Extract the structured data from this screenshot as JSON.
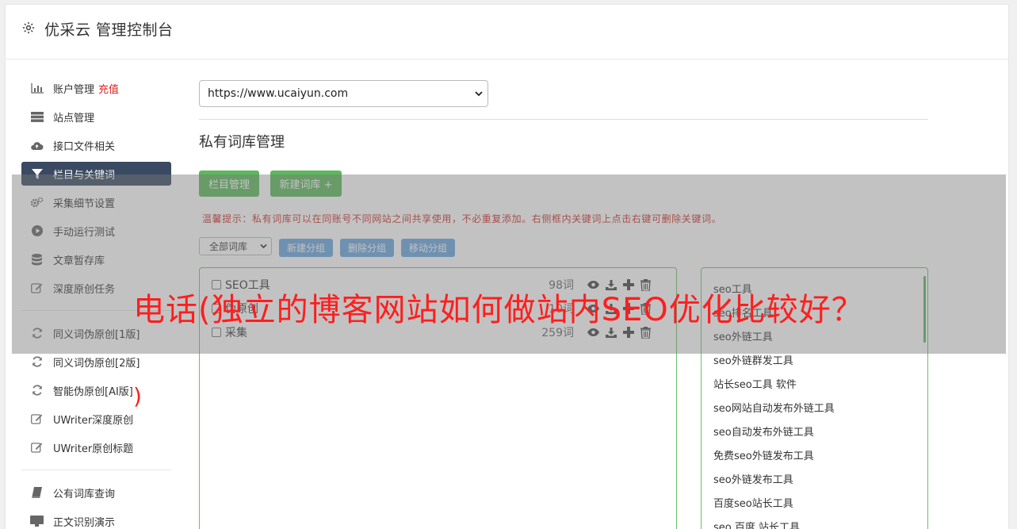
{
  "header": {
    "title": "优采云 管理控制台"
  },
  "sidebar": {
    "group1": [
      {
        "label": "账户管理",
        "badge": "充值",
        "icon": "bar-chart-icon"
      },
      {
        "label": "站点管理",
        "icon": "server-icon"
      },
      {
        "label": "接口文件相关",
        "icon": "cloud-upload-icon"
      },
      {
        "label": "栏目与关键词",
        "icon": "filter-icon",
        "active": true
      },
      {
        "label": "采集细节设置",
        "icon": "cogs-icon"
      },
      {
        "label": "手动运行测试",
        "icon": "play-circle-icon"
      },
      {
        "label": "文章暂存库",
        "icon": "database-icon"
      },
      {
        "label": "深度原创任务",
        "icon": "edit-icon"
      }
    ],
    "group2": [
      {
        "label": "同义词伪原创[1版]",
        "icon": "refresh-icon"
      },
      {
        "label": "同义词伪原创[2版]",
        "icon": "refresh-icon"
      },
      {
        "label": "智能伪原创[AI版]",
        "icon": "refresh-icon"
      },
      {
        "label": "UWriter深度原创",
        "icon": "edit-icon"
      },
      {
        "label": "UWriter原创标题",
        "icon": "edit-icon"
      }
    ],
    "group3": [
      {
        "label": "公有词库查询",
        "icon": "book-icon"
      },
      {
        "label": "正文识别演示",
        "icon": "monitor-icon"
      }
    ]
  },
  "main": {
    "site_select": "https://www.ucaiyun.com",
    "section_title": "私有词库管理",
    "btn_columns": "栏目管理",
    "btn_new_lib": "新建词库 +",
    "tip": "温馨提示：私有词库可以在同账号不同网站之间共享使用，不必重复添加。右侧框内关键词上点击右键可删除关键词。",
    "lib_filter": "全部词库",
    "btn_new_group": "新建分组",
    "btn_delete_group": "删除分组",
    "btn_move_group": "移动分组",
    "libraries": [
      {
        "name": "SEO工具",
        "count": "98词"
      },
      {
        "name": "伪原创",
        "count": "10词"
      },
      {
        "name": "采集",
        "count": "259词"
      }
    ],
    "keywords": [
      "seo工具",
      "seo排名工具",
      "seo外链工具",
      "seo外链群发工具",
      "站长seo工具 软件",
      "seo网站自动发布外链工具",
      "seo自动发布外链工具",
      "免费seo外链发布工具",
      "seo外链发布工具",
      "百度seo站长工具",
      "seo 百度 站长工具"
    ]
  },
  "overlay": {
    "text": "电话(独立的博客网站如何做站内SEO优化比较好？",
    "paren": ")"
  },
  "colors": {
    "green": "#5cb85c",
    "blue": "#69a6e0",
    "nav_active": "#3a4a62",
    "tip_red": "#c9302c",
    "overlay_red": "#ff1e1e"
  }
}
